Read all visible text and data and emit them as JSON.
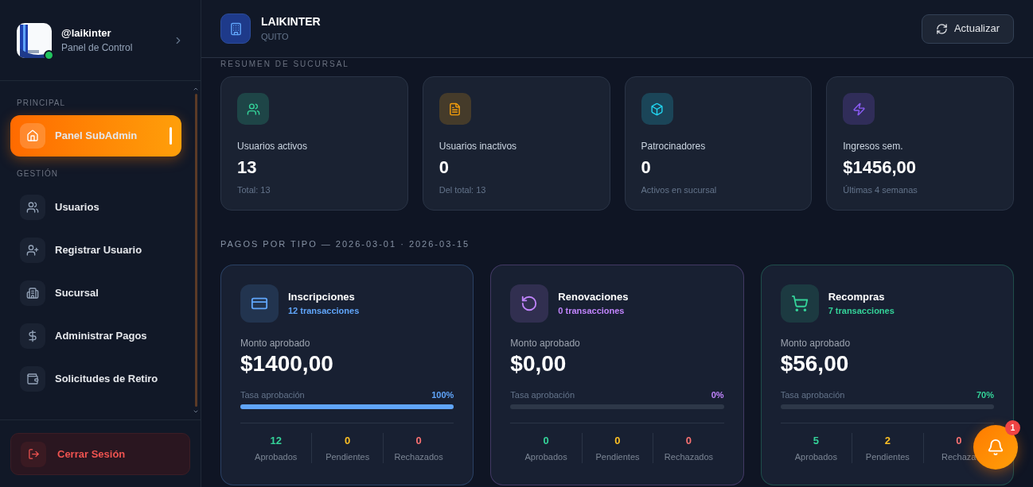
{
  "sidebar": {
    "user": {
      "handle": "@laikinter",
      "subtitle": "Panel de Control"
    },
    "sections": [
      {
        "title": "PRINCIPAL",
        "items": [
          {
            "label": "Panel SubAdmin",
            "selected": true
          }
        ]
      },
      {
        "title": "GESTIÓN",
        "items": [
          {
            "label": "Usuarios",
            "selected": false
          },
          {
            "label": "Registrar Usuario",
            "selected": false
          },
          {
            "label": "Sucursal",
            "selected": false
          },
          {
            "label": "Administrar Pagos",
            "selected": false
          },
          {
            "label": "Solicitudes de Retiro",
            "selected": false
          }
        ]
      }
    ],
    "logout": "Cerrar Sesión"
  },
  "header": {
    "title": "LAIKINTER",
    "subtitle": "QUITO",
    "refresh": "Actualizar"
  },
  "summary": {
    "title": "RESUMEN DE SUCURSAL",
    "cards": [
      {
        "label": "Usuarios activos",
        "value": "13",
        "note": "Total: 13",
        "color": "#34d399"
      },
      {
        "label": "Usuarios inactivos",
        "value": "0",
        "note": "Del total: 13",
        "color": "#f59e0b"
      },
      {
        "label": "Patrocinadores",
        "value": "0",
        "note": "Activos en sucursal",
        "color": "#22d3ee"
      },
      {
        "label": "Ingresos sem.",
        "value": "$1456,00",
        "note": "Últimas 4 semanas",
        "color": "#8b5cf6"
      }
    ]
  },
  "payments": {
    "title": "PAGOS POR TIPO — 2026-03-01 · 2026-03-15",
    "cards": [
      {
        "name": "Inscripciones",
        "count": "12 transacciones",
        "color": "#60a5fa",
        "amount_label": "Monto aprobado",
        "amount": "$1400,00",
        "rate_label": "Tasa aprobación",
        "rate": "100%",
        "level": 1,
        "stats": [
          {
            "value": "12",
            "label": "Aprobados",
            "kind": "approved"
          },
          {
            "value": "0",
            "label": "Pendientes",
            "kind": "pending"
          },
          {
            "value": "0",
            "label": "Rechazados",
            "kind": "rejected"
          }
        ]
      },
      {
        "name": "Renovaciones",
        "count": "0 transacciones",
        "color": "#c084fc",
        "amount_label": "Monto aprobado",
        "amount": "$0,00",
        "rate_label": "Tasa aprobación",
        "rate": "0%",
        "level": 0,
        "stats": [
          {
            "value": "0",
            "label": "Aprobados",
            "kind": "approved"
          },
          {
            "value": "0",
            "label": "Pendientes",
            "kind": "pending"
          },
          {
            "value": "0",
            "label": "Rechazados",
            "kind": "rejected"
          }
        ]
      },
      {
        "name": "Recompras",
        "count": "7 transacciones",
        "color": "#34d399",
        "amount_label": "Monto aprobado",
        "amount": "$56,00",
        "rate_label": "Tasa aprobación",
        "rate": "70%",
        "level": 0,
        "stats": [
          {
            "value": "5",
            "label": "Aprobados",
            "kind": "approved"
          },
          {
            "value": "2",
            "label": "Pendientes",
            "kind": "pending"
          },
          {
            "value": "0",
            "label": "Rechaza",
            "kind": "rejected"
          }
        ]
      }
    ]
  },
  "notifications": {
    "count": "1"
  }
}
